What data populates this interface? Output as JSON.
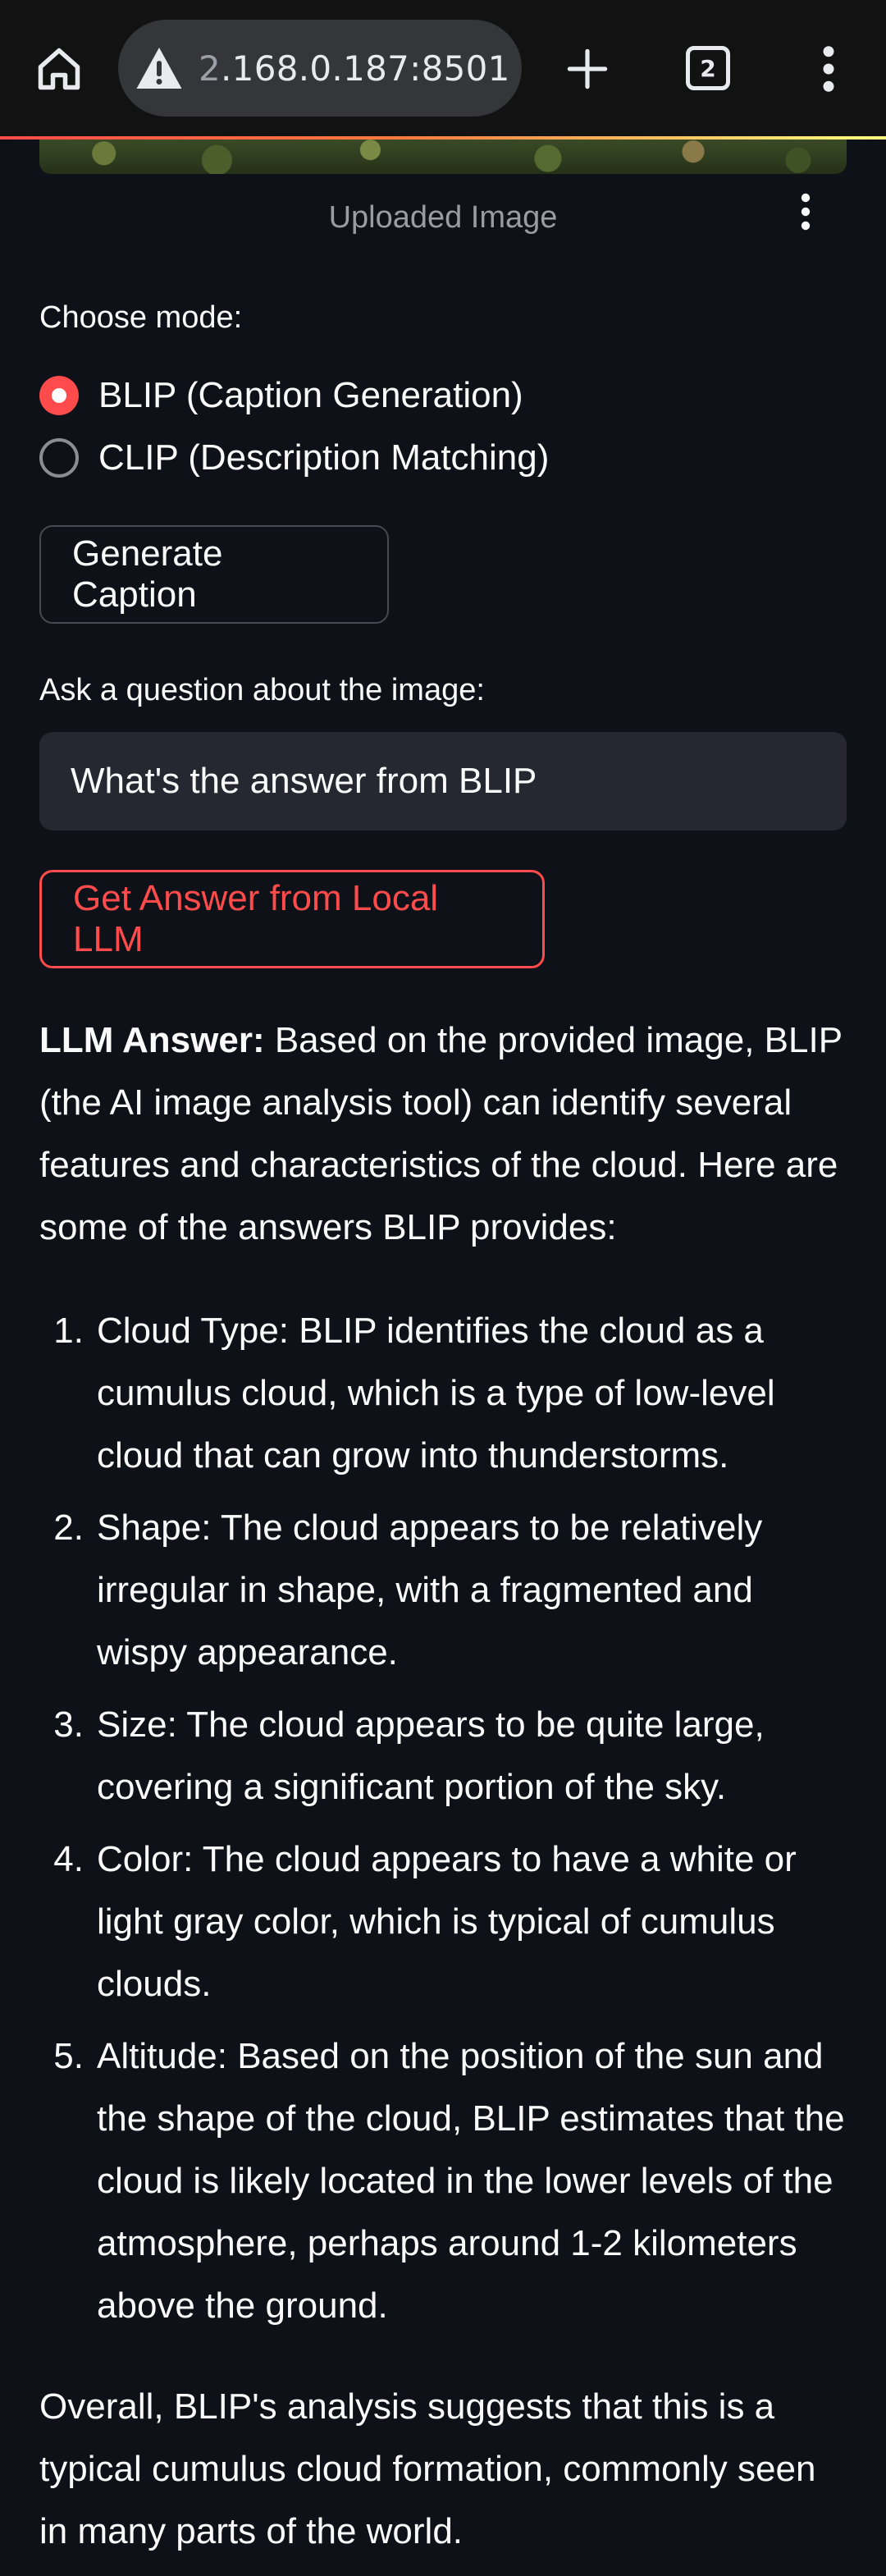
{
  "browser": {
    "url_prefix": "2",
    "url_rest": ".168.0.187:8501",
    "tab_count": "2",
    "icons": [
      "home-icon",
      "warning-icon",
      "plus-icon",
      "tabs-icon",
      "more-vert-icon"
    ]
  },
  "image_block": {
    "caption": "Uploaded Image"
  },
  "mode": {
    "label": "Choose mode:",
    "options": [
      {
        "label": "BLIP (Caption Generation)",
        "selected": true
      },
      {
        "label": "CLIP (Description Matching)",
        "selected": false
      }
    ]
  },
  "caption_button": {
    "label": "Generate Caption"
  },
  "question": {
    "label": "Ask a question about the image:",
    "value": "What's the answer from BLIP"
  },
  "llm_button": {
    "label": "Get Answer from Local LLM"
  },
  "answer": {
    "heading": "LLM Answer:",
    "intro": "Based on the provided image, BLIP (the AI image analysis tool) can identify several features and characteristics of the cloud. Here are some of the answers BLIP provides:",
    "items": [
      {
        "num": "1.",
        "text": "Cloud Type: BLIP identifies the cloud as a cumulus cloud, which is a type of low-level cloud that can grow into thunderstorms."
      },
      {
        "num": "2.",
        "text": "Shape: The cloud appears to be relatively irregular in shape, with a fragmented and wispy appearance."
      },
      {
        "num": "3.",
        "text": "Size: The cloud appears to be quite large, covering a significant portion of the sky."
      },
      {
        "num": "4.",
        "text": "Color: The cloud appears to have a white or light gray color, which is typical of cumulus clouds."
      },
      {
        "num": "5.",
        "text": "Altitude: Based on the position of the sun and the shape of the cloud, BLIP estimates that the cloud is likely located in the lower levels of the atmosphere, perhaps around 1-2 kilometers above the ground."
      }
    ],
    "summary": "Overall, BLIP's analysis suggests that this is a typical cumulus cloud formation, commonly seen in many parts of the world."
  },
  "colors": {
    "background": "#0e1117",
    "accent": "#ff4b4b",
    "input_bg": "#262730",
    "chrome_bg": "#121212"
  }
}
